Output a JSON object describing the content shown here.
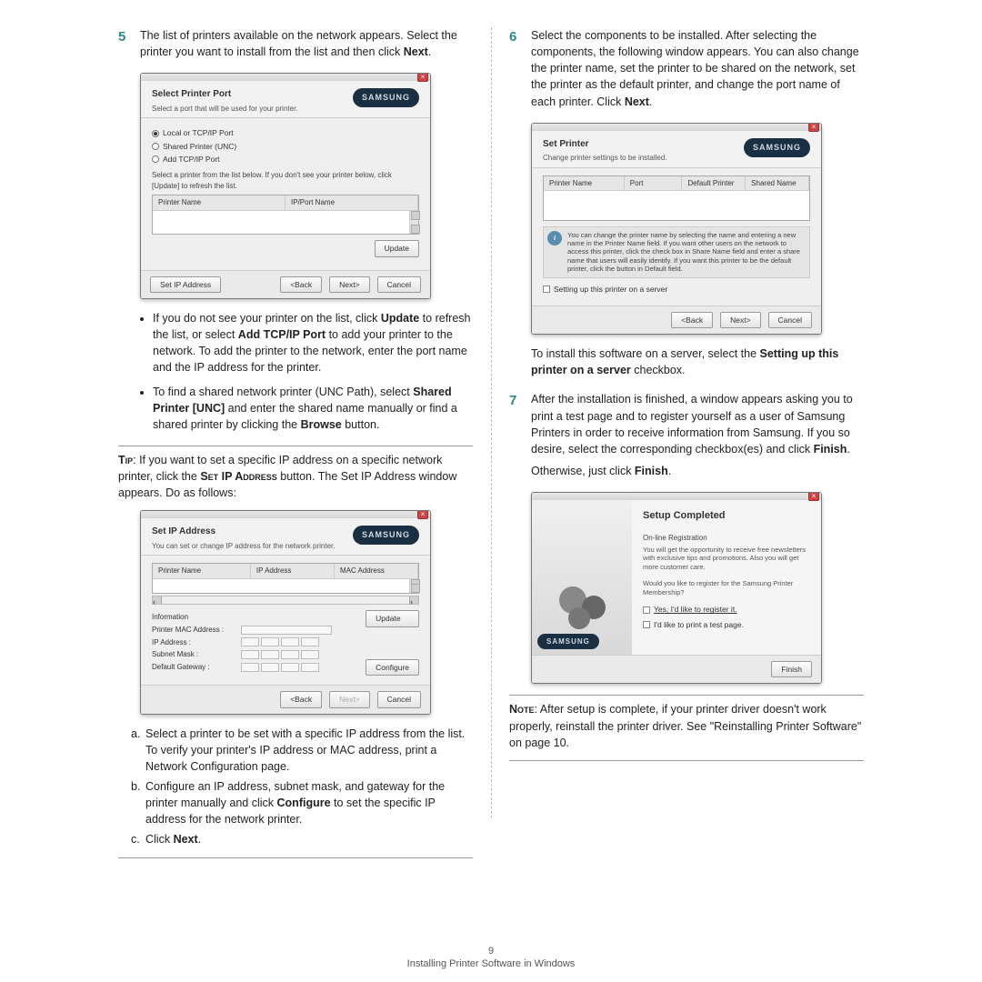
{
  "leftCol": {
    "step5": {
      "num": "5",
      "text": "The list of printers available on the network appears. Select the printer you want to install from the list and then click ",
      "bold": "Next",
      "period": "."
    },
    "win1": {
      "title": "Select Printer Port",
      "subtitle": "Select a port that will be used for your printer.",
      "brand": "SAMSUNG",
      "radio1": "Local or TCP/IP Port",
      "radio2": "Shared Printer (UNC)",
      "radio3": "Add TCP/IP Port",
      "instr": "Select a printer from the list below. If you don't see your printer below, click [Update] to refresh the list.",
      "colA": "Printer Name",
      "colB": "IP/Port Name",
      "update": "Update",
      "setip": "Set IP Address",
      "back": "<Back",
      "next": "Next>",
      "cancel": "Cancel"
    },
    "bullets": {
      "b1a": "If you do not see your printer on the list, click ",
      "b1b": "Update",
      "b1c": " to refresh the list, or select ",
      "b1d": "Add TCP/IP Port",
      "b1e": " to add your printer to the network. To add the printer to the network, enter the port name and the IP address for the printer.",
      "b2a": "To find a shared network printer (UNC Path), select ",
      "b2b": "Shared Printer [UNC]",
      "b2c": " and enter the shared name manually or find a shared printer by clicking the ",
      "b2d": "Browse",
      "b2e": " button."
    },
    "tip": {
      "label": "Tip",
      "a": ": If you want to set a specific IP address on a specific network printer, click the ",
      "b": "Set IP Address",
      "c": " button. The Set IP Address window appears. Do as follows:"
    },
    "win2": {
      "title": "Set IP Address",
      "subtitle": "You can set or change IP address for the network printer.",
      "brand": "SAMSUNG",
      "colA": "Printer Name",
      "colB": "IP Address",
      "colC": "MAC Address",
      "update": "Update",
      "info": "Information",
      "mac": "Printer MAC Address :",
      "ip": "IP Address :",
      "sub": "Subnet Mask :",
      "gw": "Default Gateway :",
      "configure": "Configure",
      "back": "<Back",
      "next": "Next>",
      "cancel": "Cancel"
    },
    "lettered": {
      "a": "Select a printer to be set with a specific IP address from the list. To verify your printer's IP address or MAC address, print a Network Configuration page.",
      "b1": "Configure an IP address, subnet mask, and gateway for the printer manually and click ",
      "b2": "Configure",
      "b3": " to set the specific IP address for the network printer.",
      "c1": "Click ",
      "c2": "Next",
      "c3": "."
    }
  },
  "rightCol": {
    "step6": {
      "num": "6",
      "text": "Select the components to be installed. After selecting the components, the following window appears. You can also change the printer name, set the printer to be shared on the network, set the printer as the default printer, and change the port name of each printer. Click ",
      "bold": "Next",
      "period": "."
    },
    "win3": {
      "title": "Set Printer",
      "subtitle": "Change printer settings to be installed.",
      "brand": "SAMSUNG",
      "colA": "Printer Name",
      "colB": "Port",
      "colC": "Default Printer",
      "colD": "Shared Name",
      "infoText": "You can change the printer name by selecting the name and entering a new name in the Printer Name field. If you want other users on the network to access this printer, click the check box in Share Name field and enter a share name that users will easily identify. If you want this printer to be the default printer, click the button in Default field.",
      "chk": "Setting up this printer on a server",
      "back": "<Back",
      "next": "Next>",
      "cancel": "Cancel"
    },
    "serverNote": {
      "a": "To install this software on a server, select the ",
      "b": "Setting up this printer on a server",
      "c": " checkbox."
    },
    "step7": {
      "num": "7",
      "a": "After the installation is finished, a window appears asking you to print a test page and to register yourself as a user of Samsung Printers in order to receive information from Samsung. If you so desire, select the corresponding checkbox(es) and click ",
      "b": "Finish",
      "c": ".",
      "d": "Otherwise, just click ",
      "e": "Finish",
      "f": "."
    },
    "win4": {
      "title": "Setup Completed",
      "sub": "On-line Registration",
      "small": "You will get the opportunity to receive free newsletters with exclusive tips and promotions. Also you will get more customer care.",
      "q": "Would you like to register for the Samsung Printer Membership?",
      "chk1": "Yes, I'd like to register it.",
      "chk2": "I'd like to print a test page.",
      "brand": "SAMSUNG",
      "finish": "Finish"
    },
    "note": {
      "label": "Note",
      "text": ": After setup is complete, if your printer driver doesn't work properly, reinstall the printer driver. See \"Reinstalling Printer Software\" on page 10."
    }
  },
  "footer": {
    "num": "9",
    "text": "Installing Printer Software in Windows"
  }
}
